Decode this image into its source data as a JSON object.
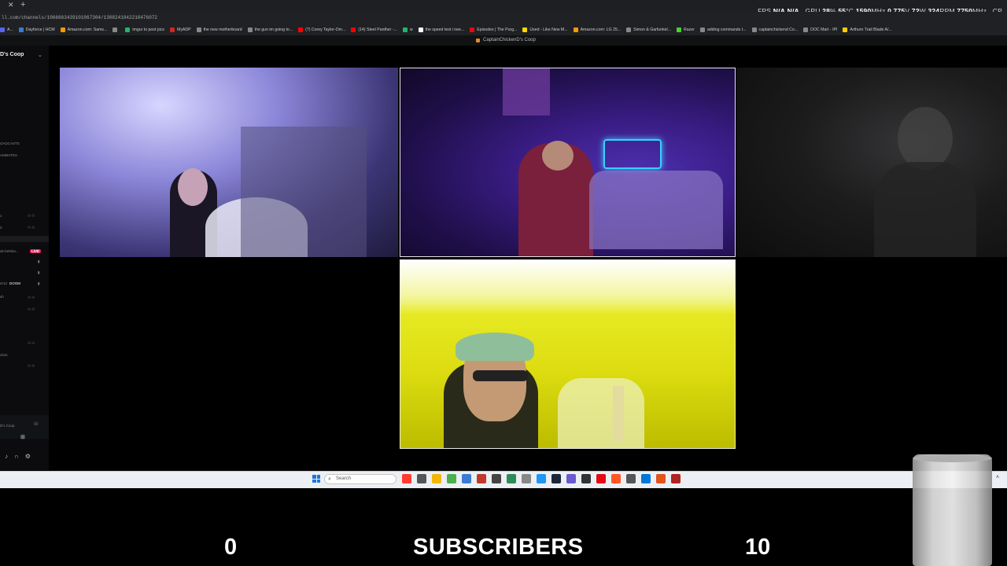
{
  "browser": {
    "tab_close": "✕",
    "tab_new": "+",
    "url": "ll.com/channels/1066663439101067304/1308241842210476072",
    "bookmarks": [
      {
        "label": "A...",
        "color": "#5865f2"
      },
      {
        "label": "Dayforce | HCM",
        "color": "#3a7bd5"
      },
      {
        "label": "Amazon.com: Sams...",
        "color": "#ff9900"
      },
      {
        "label": "",
        "color": "#888888"
      },
      {
        "label": "imgur to post pics",
        "color": "#1bb76e"
      },
      {
        "label": "MyADP",
        "color": "#d0271d"
      },
      {
        "label": "the new motherboard",
        "color": "#888888"
      },
      {
        "label": "the gun im going to...",
        "color": "#888888"
      },
      {
        "label": "(7) Corey Taylor-Om...",
        "color": "#ff0000"
      },
      {
        "label": "(14) Steel Panther -...",
        "color": "#ff0000"
      },
      {
        "label": "w",
        "color": "#1bb76e"
      },
      {
        "label": "the speed test i nee...",
        "color": "#ffffff"
      },
      {
        "label": "Episodes | The Purg...",
        "color": "#e50914"
      },
      {
        "label": "Used - Like New M...",
        "color": "#ffd700"
      },
      {
        "label": "Amazon.com: LG 25...",
        "color": "#ff9900"
      },
      {
        "label": "Simon & Garfunkel...",
        "color": "#888888"
      },
      {
        "label": "Razer",
        "color": "#44d62c"
      },
      {
        "label": "adding commands t...",
        "color": "#888888"
      },
      {
        "label": "captainchickend Co...",
        "color": "#888888"
      },
      {
        "label": "DOC Mart - IPI",
        "color": "#888888"
      },
      {
        "label": "Arthuro Trail Blade A/...",
        "color": "#ffcc00"
      }
    ]
  },
  "overlay": {
    "fps_label": "FPS",
    "fps_value": "N/A",
    "fps_value2": "N/A",
    "gpu_label": "GPU",
    "gpu_load": "28",
    "gpu_load_unit": "%",
    "gpu_temp": "55",
    "gpu_temp_unit": "°C",
    "gpu_clock": "1590",
    "gpu_clock_unit": "MHz",
    "gpu_volt": "0.775",
    "gpu_volt_unit": "V",
    "gpu_power": "72",
    "gpu_power_unit": "W",
    "gpu_fan": "324",
    "gpu_fan_unit": "RPM",
    "gpu_mem": "7750",
    "gpu_mem_unit": "MHz",
    "cpu_label": "CP"
  },
  "window_title": "CaptainChickenD's Coop",
  "sidebar": {
    "server_name": "D's Coop",
    "items": [
      {
        "label": "OADCASTS"
      },
      {
        "label": "AMMATES"
      },
      {
        "label": "1"
      },
      {
        "label": "2"
      },
      {
        "label": "ak-bettina..."
      },
      {
        "label": "er12"
      },
      {
        "label": "sh"
      },
      {
        "label": "ction"
      }
    ],
    "live_badge": "LIVE",
    "doom_tag": "DOOM",
    "voice_status": "D's Coop"
  },
  "taskbar": {
    "search_placeholder": "Search",
    "apps": [
      "#ff3b30",
      "#555555",
      "#f2b705",
      "#4caf50",
      "#3a7bd5",
      "#c0392b",
      "#444444",
      "#2e8b57",
      "#888888",
      "#2196f3",
      "#1b2838",
      "#6a5acd",
      "#333333",
      "#e50914",
      "#ff5722",
      "#555555",
      "#0078d7",
      "#e2531d",
      "#b22222"
    ]
  },
  "stream_overlay": {
    "left_count": "0",
    "label": "SUBSCRIBERS",
    "right_count": "10"
  }
}
